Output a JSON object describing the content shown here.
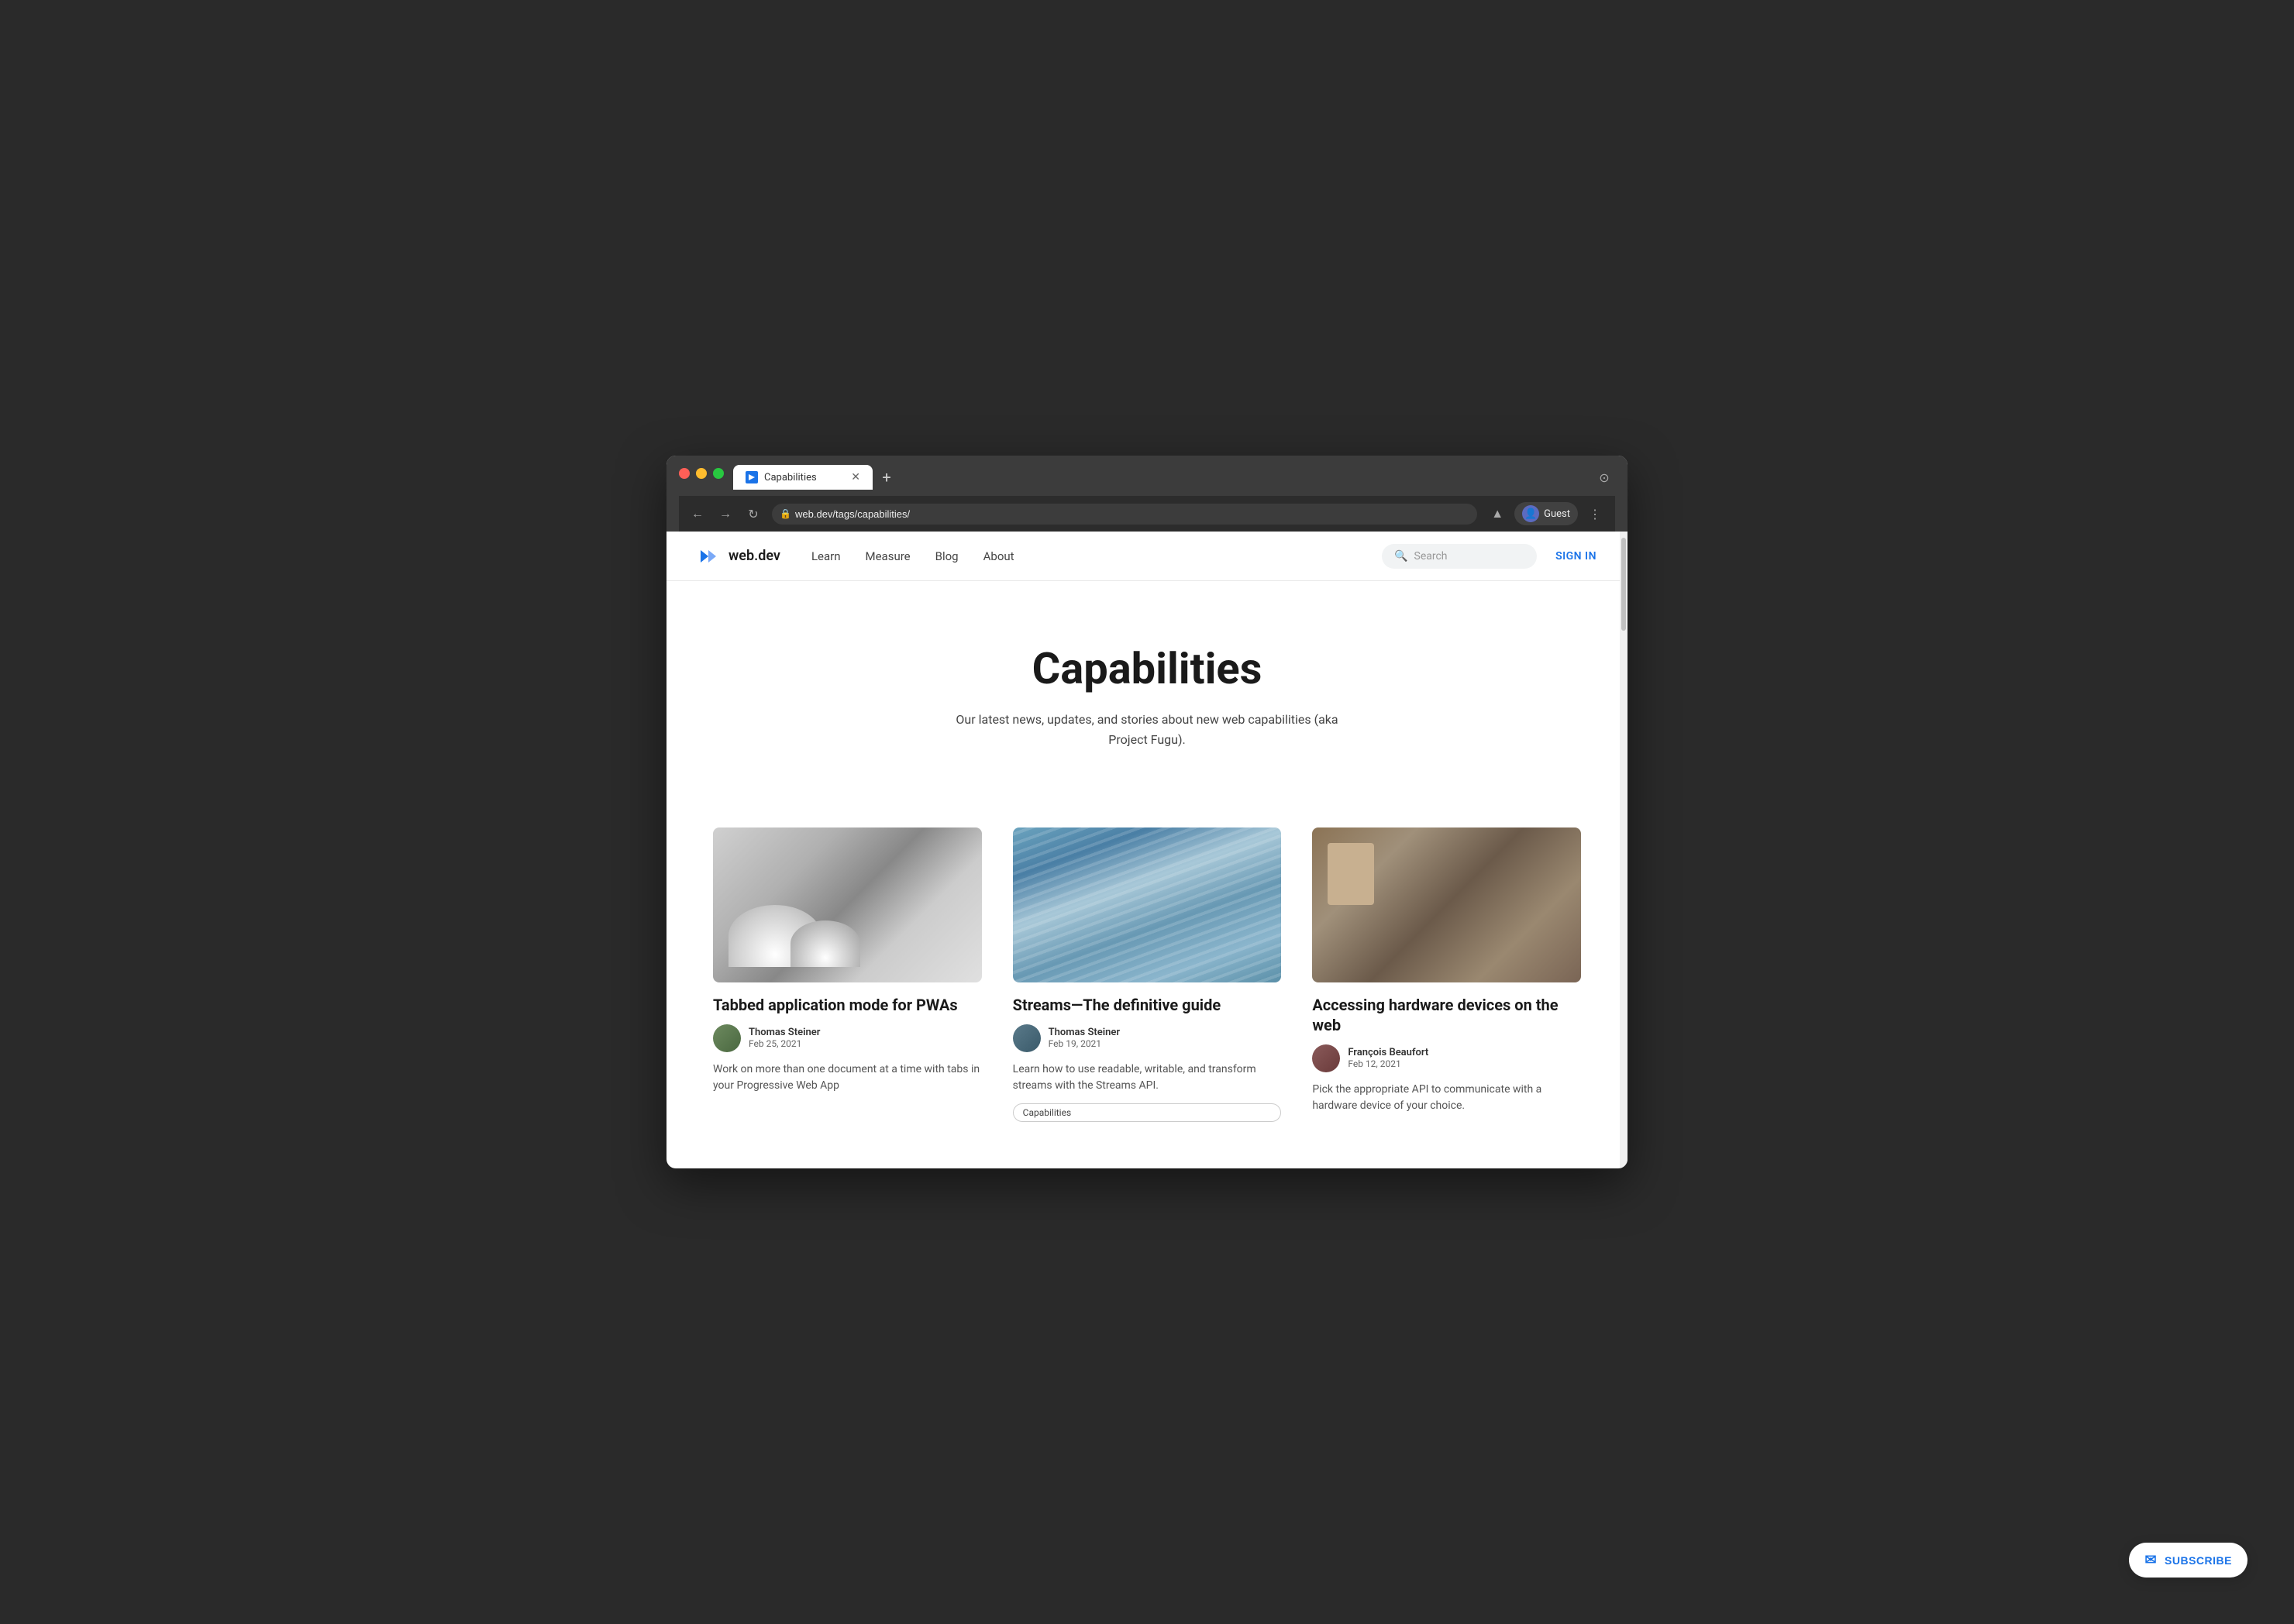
{
  "browser": {
    "tab_title": "Capabilities",
    "tab_favicon": "▶",
    "address": "web.dev/tags/capabilities/",
    "new_tab_label": "+",
    "nav_back": "←",
    "nav_forward": "→",
    "nav_reload": "↻",
    "profile_label": "Guest",
    "more_options": "⋮",
    "extensions_icon": "▲"
  },
  "nav": {
    "logo_text": "web.dev",
    "links": [
      {
        "label": "Learn",
        "id": "learn"
      },
      {
        "label": "Measure",
        "id": "measure"
      },
      {
        "label": "Blog",
        "id": "blog"
      },
      {
        "label": "About",
        "id": "about"
      }
    ],
    "search_placeholder": "Search",
    "signin_label": "SIGN IN"
  },
  "hero": {
    "title": "Capabilities",
    "description": "Our latest news, updates, and stories about new web capabilities (aka Project Fugu)."
  },
  "articles": [
    {
      "id": "article-1",
      "title": "Tabbed application mode for PWAs",
      "author_name": "Thomas Steiner",
      "author_date": "Feb 25, 2021",
      "excerpt": "Work on more than one document at a time with tabs in your Progressive Web App",
      "tag": null,
      "img_class": "img-domes"
    },
    {
      "id": "article-2",
      "title": "Streams—The definitive guide",
      "author_name": "Thomas Steiner",
      "author_date": "Feb 19, 2021",
      "excerpt": "Learn how to use readable, writable, and transform streams with the Streams API.",
      "tag": "Capabilities",
      "img_class": "img-streams"
    },
    {
      "id": "article-3",
      "title": "Accessing hardware devices on the web",
      "author_name": "François Beaufort",
      "author_date": "Feb 12, 2021",
      "excerpt": "Pick the appropriate API to communicate with a hardware device of your choice.",
      "tag": null,
      "img_class": "img-workshop"
    }
  ],
  "subscribe": {
    "label": "SUBSCRIBE",
    "icon": "✉"
  }
}
